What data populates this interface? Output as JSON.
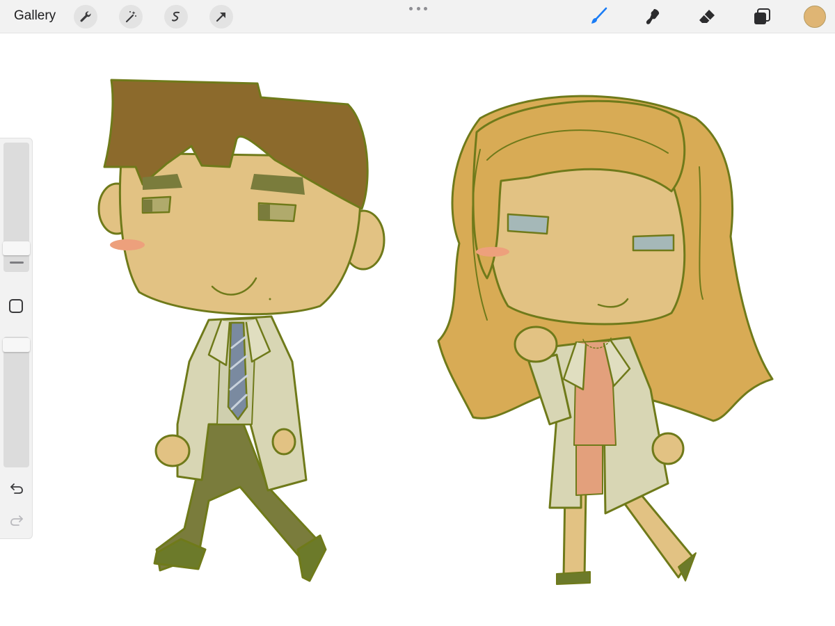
{
  "topbar": {
    "gallery_label": "Gallery",
    "left_tools": [
      {
        "icon": "wrench-icon",
        "name": "actions"
      },
      {
        "icon": "magic-wand-icon",
        "name": "adjustments"
      },
      {
        "icon": "selection-icon",
        "name": "selection"
      },
      {
        "icon": "transform-arrow-icon",
        "name": "transform"
      }
    ],
    "right_tools": [
      {
        "icon": "brush-icon",
        "name": "brush",
        "active": true
      },
      {
        "icon": "smudge-icon",
        "name": "smudge"
      },
      {
        "icon": "eraser-icon",
        "name": "eraser"
      },
      {
        "icon": "layers-icon",
        "name": "layers"
      }
    ],
    "current_color": "#dfb574"
  },
  "sidebar": {
    "brush_size_level": 0.3,
    "opacity_level": 0.0
  },
  "colors": {
    "accent": "#1a7cf5",
    "outline": "#6f7a1a",
    "skin": "#e2c283",
    "brown_hair": "#8c6a2c",
    "blonde_hair": "#d8ab55",
    "lab_coat": "#d8d6b4",
    "trousers": "#7a7c3c",
    "tie": "#7a8aa0",
    "blouse": "#e3a07c",
    "eye_green": "#b0aa6c",
    "eye_blue": "#a5b8b8",
    "blush": "#eda07c"
  }
}
